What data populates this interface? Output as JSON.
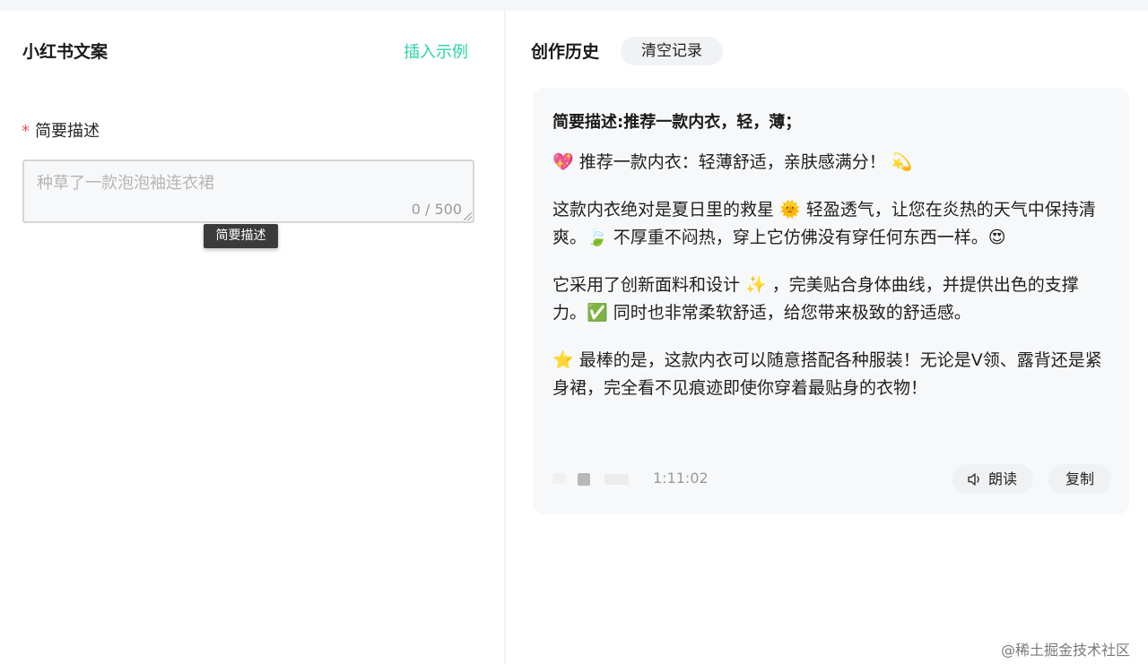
{
  "left_panel": {
    "title": "小红书文案",
    "insert_example": "插入示例",
    "field_required_mark": "*",
    "field_label": "简要描述",
    "textarea_placeholder": "种草了一款泡泡袖连衣裙",
    "counter": "0 / 500",
    "tooltip": "简要描述"
  },
  "right_panel": {
    "title": "创作历史",
    "clear_button": "清空记录",
    "card": {
      "heading": "简要描述:推荐一款内衣，轻，薄；",
      "paragraphs": [
        "💖 推荐一款内衣：轻薄舒适，亲肤感满分！ 💫",
        "这款内衣绝对是夏日里的救星 🌞 轻盈透气，让您在炎热的天气中保持清爽。🍃 不厚重不闷热，穿上它仿佛没有穿任何东西一样。😍",
        "它采用了创新面料和设计 ✨ ，完美贴合身体曲线，并提供出色的支撑力。✅ 同时也非常柔软舒适，给您带来极致的舒适感。",
        "⭐ 最棒的是，这款内衣可以随意搭配各种服装！无论是V领、露背还是紧身裙，完全看不见痕迹即使你穿着最贴身的衣物！"
      ],
      "timestamp": "1:11:02",
      "read_button": "朗读",
      "copy_button": "复制"
    }
  },
  "watermark": "@稀土掘金技术社区",
  "colors": {
    "accent": "#2ed3a8",
    "required": "#f04f4f",
    "card_bg": "#f7f8fa",
    "tooltip_bg": "#3b3b3b"
  },
  "icons": {
    "read": "speaker-icon",
    "resize": "resize-handle-icon"
  }
}
